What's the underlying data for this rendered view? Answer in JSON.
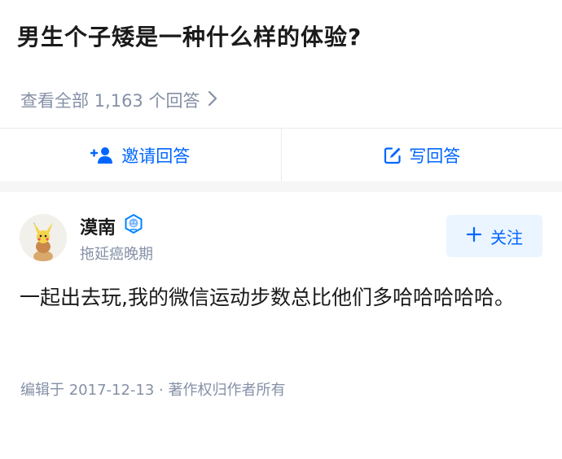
{
  "question": {
    "title": "男生个子矮是一种什么样的体验?",
    "view_all": "查看全部 1,163 个回答",
    "view_all_icon": "chevron-right-icon"
  },
  "actions": {
    "invite_label": "邀请回答",
    "invite_icon": "add-person-icon",
    "write_label": "写回答",
    "write_icon": "edit-icon"
  },
  "answer": {
    "author": {
      "name": "漠南",
      "bio": "拖延癌晚期",
      "badge_icon": "verified-badge-icon",
      "follow_label": "关注"
    },
    "content": "一起出去玩,我的微信运动步数总比他们多哈哈哈哈哈。",
    "meta": "编辑于 2017-12-13 · 著作权归作者所有"
  },
  "colors": {
    "accent": "#0066ff",
    "muted": "#8590a6",
    "text": "#1a1a1a",
    "follow_bg": "#ebf5ff",
    "divider": "#ebebeb",
    "gap": "#f6f6f6"
  }
}
